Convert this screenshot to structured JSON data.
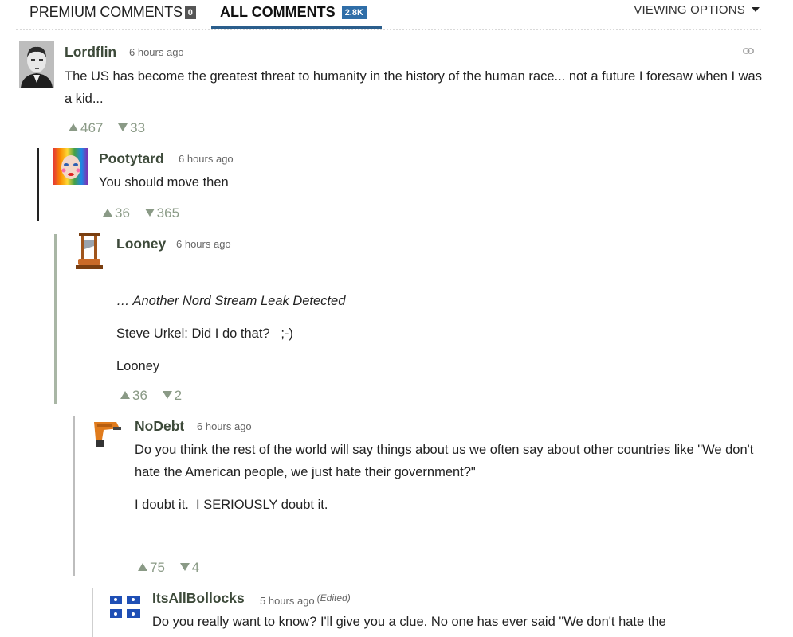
{
  "tabs": {
    "premium_label": "PREMIUM COMMENTS",
    "premium_count": "0",
    "all_label": "ALL COMMENTS",
    "all_count": "2.8K",
    "viewing_options": "VIEWING OPTIONS"
  },
  "controls": {
    "collapse": "–",
    "link": "⊝"
  },
  "comments": [
    {
      "username": "Lordflin",
      "time": "6 hours ago",
      "paragraphs": [
        "The US has become the greatest threat to humanity in the history of the human race... not a future I foresaw when I was a kid..."
      ],
      "upvotes": "467",
      "downvotes": "33"
    },
    {
      "username": "Pootytard",
      "time": "6 hours ago",
      "paragraphs": [
        "You should move then"
      ],
      "upvotes": "36",
      "downvotes": "365"
    },
    {
      "username": "Looney",
      "time": "6 hours ago",
      "paragraphs": [
        "… Another Nord Stream Leak Detected",
        "Steve Urkel: Did I do that?   ;-)",
        "Looney"
      ],
      "upvotes": "36",
      "downvotes": "2"
    },
    {
      "username": "NoDebt",
      "time": "6 hours ago",
      "paragraphs": [
        "Do you think the rest of the world will say things about us we often say about other countries like \"We don't hate the American people, we just hate their government?\"",
        "I doubt it.  I SERIOUSLY doubt it."
      ],
      "upvotes": "75",
      "downvotes": "4"
    },
    {
      "username": "ItsAllBollocks",
      "time": "5 hours ago",
      "edited": "(Edited)",
      "paragraphs": [
        "Do you really want to know? I'll give you a clue. No one has ever said \"We don't hate the"
      ]
    }
  ]
}
